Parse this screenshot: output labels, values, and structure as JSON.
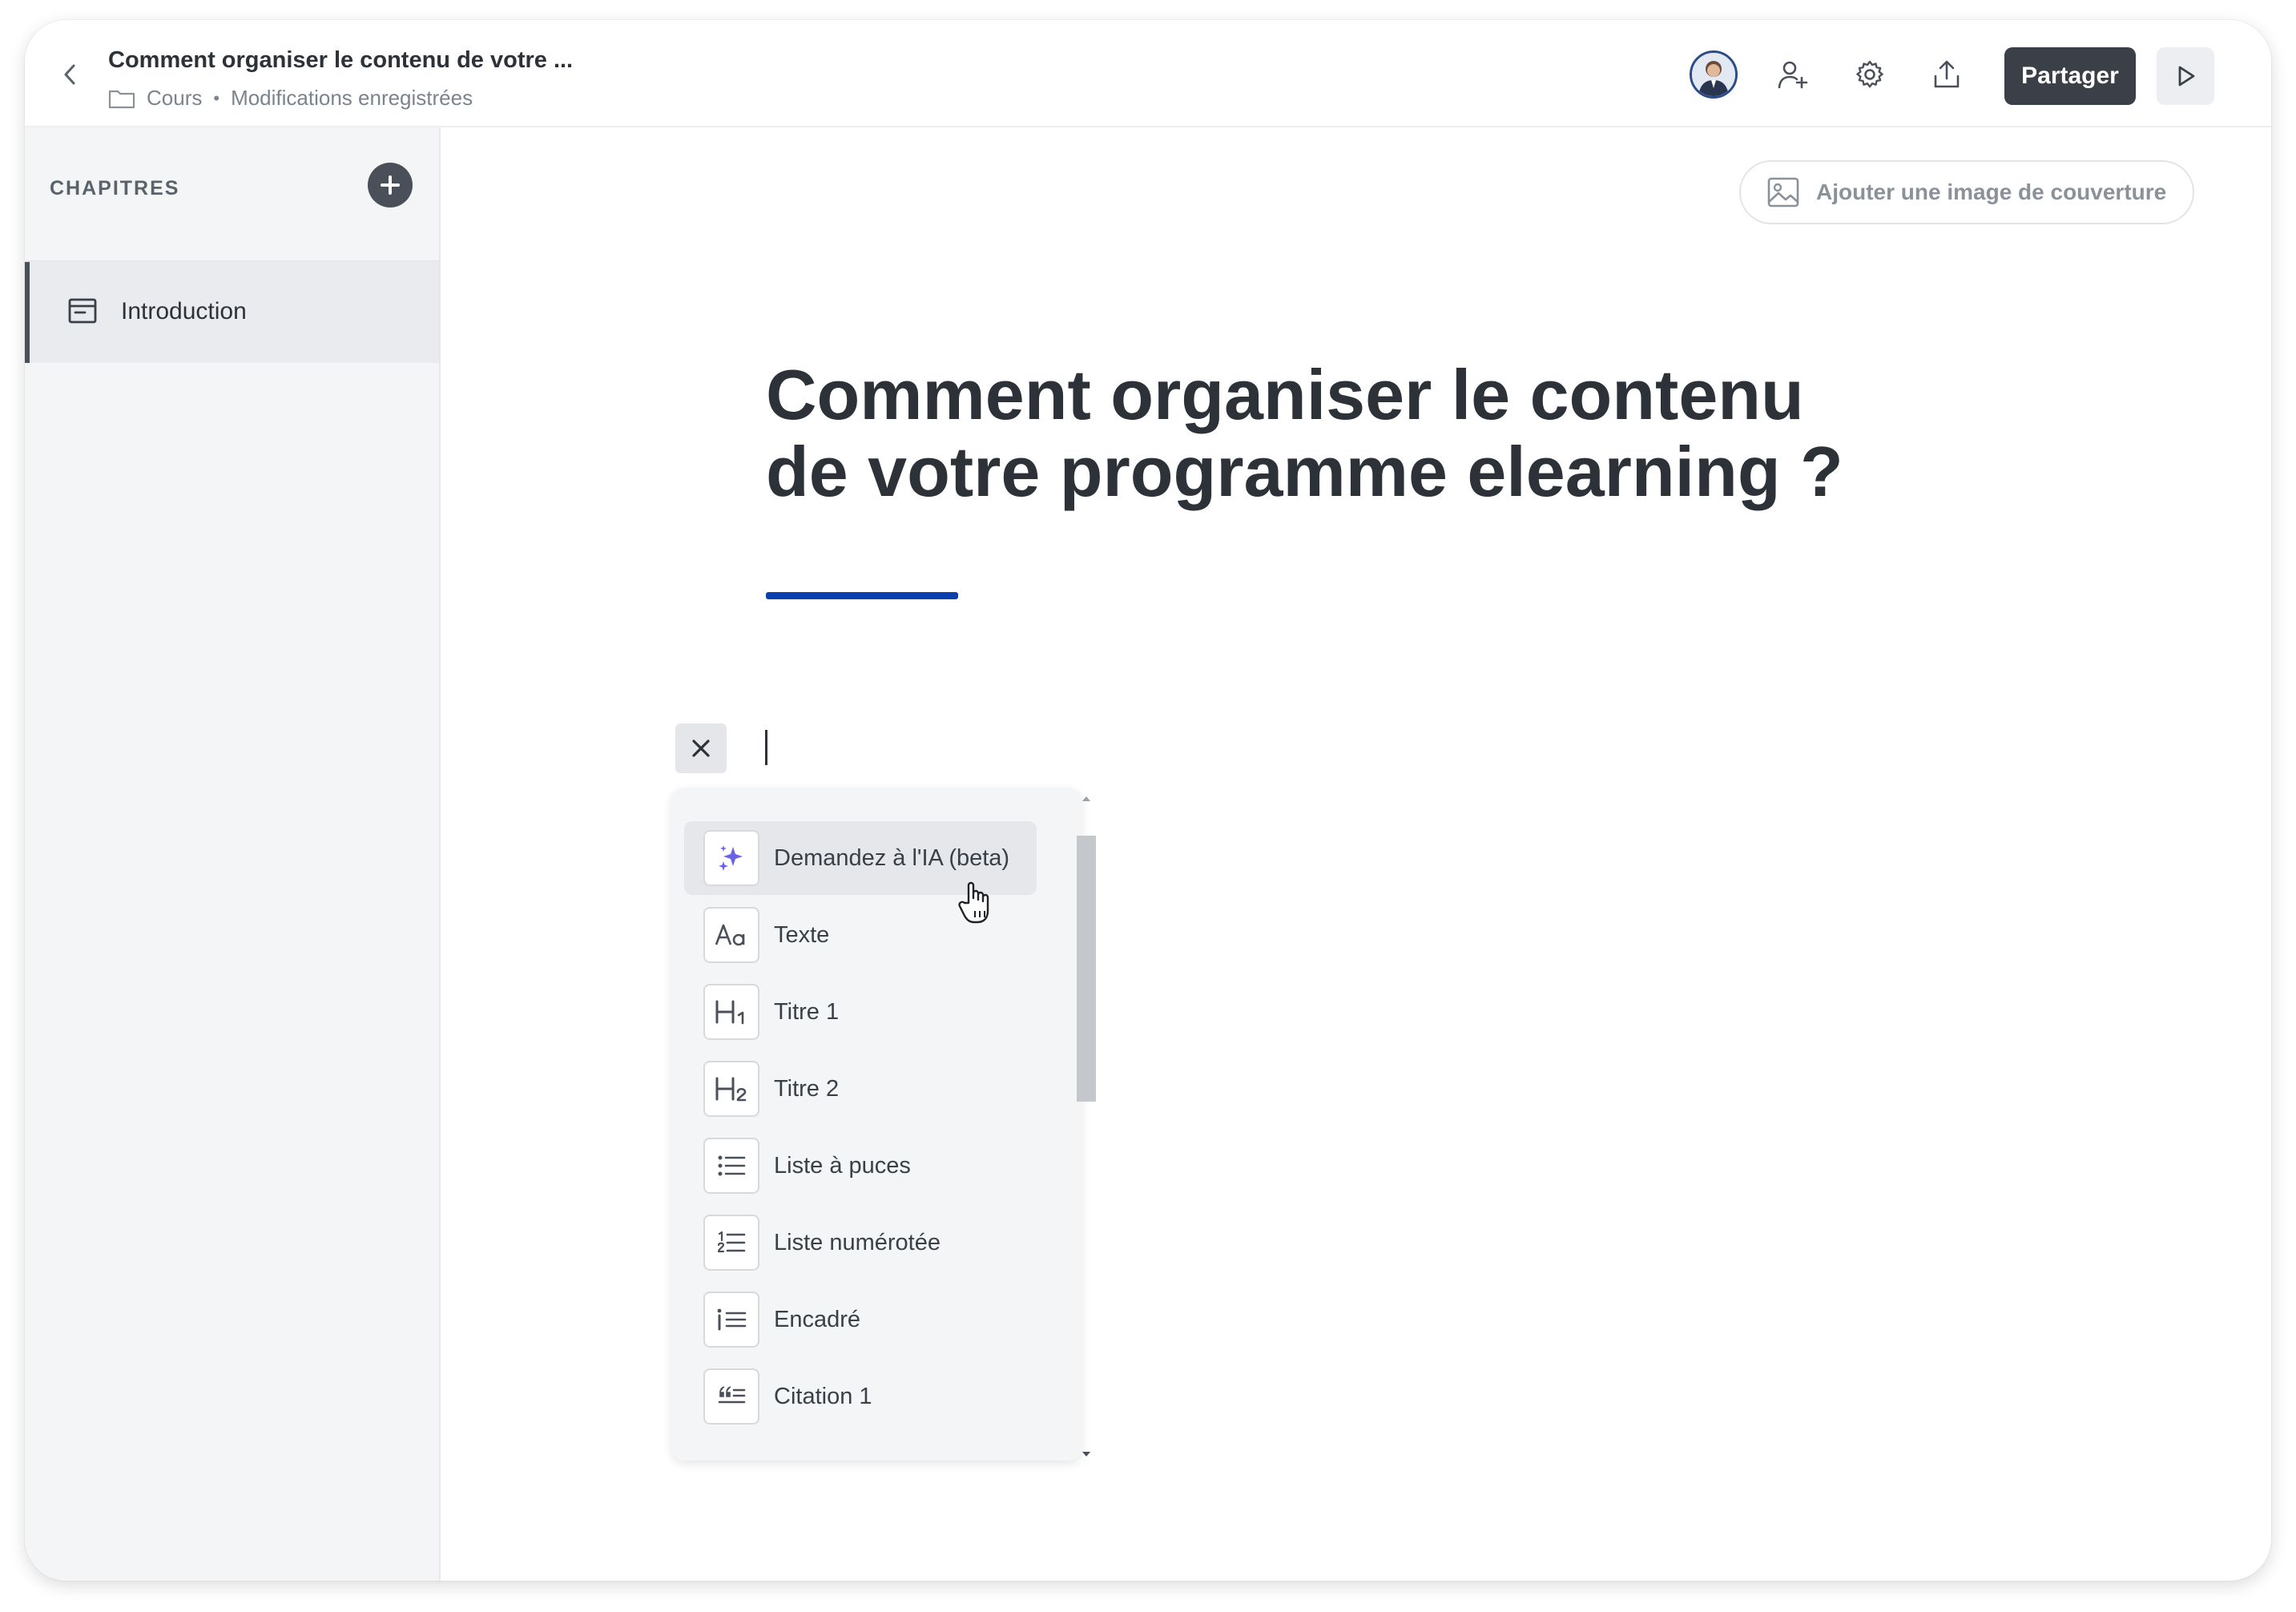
{
  "header": {
    "doc_title": "Comment organiser le contenu de votre ...",
    "breadcrumb_folder": "Cours",
    "save_status": "Modifications enregistrées",
    "share_label": "Partager",
    "icons": [
      "back-chevron-icon",
      "folder-icon",
      "avatar",
      "add-user-icon",
      "gear-icon",
      "export-icon",
      "play-icon"
    ]
  },
  "sidebar": {
    "title": "CHAPITRES",
    "chapters": [
      {
        "label": "Introduction",
        "icon": "chapter-page-icon"
      }
    ]
  },
  "main": {
    "cover_button_label": "Ajouter une image de couverture",
    "heading_line1": "Comment organiser le contenu",
    "heading_line2": "de votre programme elearning ?",
    "accent_color": "#0b3fae"
  },
  "block_menu": {
    "items": [
      {
        "label": "Demandez à l'IA (beta)",
        "icon": "sparkle-ai-icon",
        "highlighted": true
      },
      {
        "label": "Texte",
        "icon": "text-icon"
      },
      {
        "label": "Titre 1",
        "icon": "heading-1-icon"
      },
      {
        "label": "Titre 2",
        "icon": "heading-2-icon"
      },
      {
        "label": "Liste à puces",
        "icon": "bullet-list-icon"
      },
      {
        "label": "Liste numérotée",
        "icon": "numbered-list-icon"
      },
      {
        "label": "Encadré",
        "icon": "callout-icon"
      },
      {
        "label": "Citation 1",
        "icon": "quote-icon"
      }
    ]
  },
  "colors": {
    "share_button_bg": "#3b4048",
    "sidebar_bg": "#f4f5f6",
    "ai_sparkle": "#6b63e6"
  }
}
